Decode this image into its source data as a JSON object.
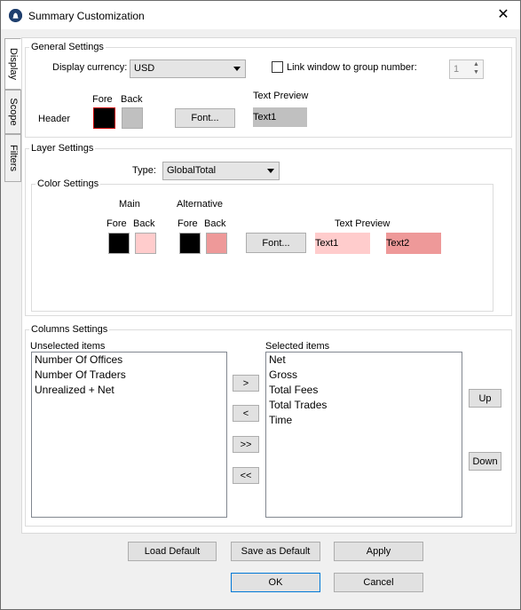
{
  "window": {
    "title": "Summary Customization",
    "close_glyph": "✕"
  },
  "tabs": [
    {
      "label": "Display"
    },
    {
      "label": "Scope"
    },
    {
      "label": "Filters"
    }
  ],
  "general": {
    "legend": "General Settings",
    "display_currency_label": "Display currency:",
    "display_currency_value": "USD",
    "link_window_label": "Link window to group number:",
    "link_window_checked": false,
    "group_number": "1",
    "header_label": "Header",
    "fore_label": "Fore",
    "back_label": "Back",
    "fore_color": "#000000",
    "back_color": "#c0c0c0",
    "font_button": "Font...",
    "text_preview_label": "Text Preview",
    "text_preview_value": "Text1",
    "text_preview_bg": "#c0c0c0"
  },
  "layer": {
    "legend": "Layer Settings",
    "type_label": "Type:",
    "type_value": "GlobalTotal",
    "color_settings": {
      "legend": "Color Settings",
      "main_label": "Main",
      "alternative_label": "Alternative",
      "main_fore_label": "Fore",
      "main_back_label": "Back",
      "alt_fore_label": "Fore",
      "alt_back_label": "Back",
      "main_fore_color": "#000000",
      "main_back_color": "#ffcccc",
      "alt_fore_color": "#000000",
      "alt_back_color": "#ee9999",
      "font_button": "Font...",
      "text_preview_label": "Text Preview",
      "preview_text1": "Text1",
      "preview_text2": "Text2"
    }
  },
  "columns": {
    "legend": "Columns Settings",
    "unselected_label": "Unselected items",
    "selected_label": "Selected items",
    "unselected_items": [
      "Number Of Offices",
      "Number Of Traders",
      "Unrealized + Net"
    ],
    "selected_items": [
      "Net",
      "Gross",
      "Total Fees",
      "Total Trades",
      "Time"
    ],
    "move_right": ">",
    "move_left": "<",
    "move_all_right": ">>",
    "move_all_left": "<<",
    "up": "Up",
    "down": "Down"
  },
  "footer": {
    "load_default": "Load Default",
    "save_as_default": "Save as Default",
    "apply": "Apply",
    "ok": "OK",
    "cancel": "Cancel"
  }
}
